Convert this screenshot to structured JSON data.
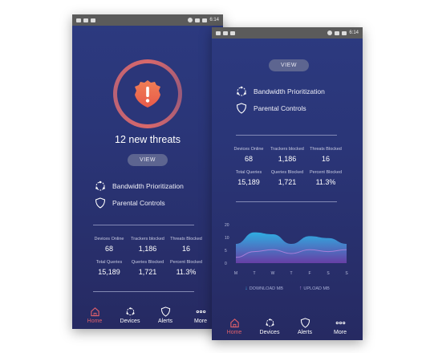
{
  "status_bar": {
    "time": "6:14"
  },
  "left_screen": {
    "threat_count_text": "12 new threats",
    "view_label": "VIEW",
    "features": [
      {
        "label": "Bandwidth Prioritization",
        "icon": "network-icon"
      },
      {
        "label": "Parental Controls",
        "icon": "shield-icon"
      }
    ],
    "stats": [
      {
        "label": "Devices Online",
        "value": "68"
      },
      {
        "label": "Trackers blocked",
        "value": "1,186"
      },
      {
        "label": "Threats Blocked",
        "value": "16"
      },
      {
        "label": "Total Queries",
        "value": "15,189"
      },
      {
        "label": "Queries Blocked",
        "value": "1,721"
      },
      {
        "label": "Percent Blocked",
        "value": "11.3%"
      }
    ]
  },
  "right_screen": {
    "view_label": "VIEW",
    "features": [
      {
        "label": "Bandwidth Prioritization",
        "icon": "network-icon"
      },
      {
        "label": "Parental Controls",
        "icon": "shield-icon"
      }
    ],
    "stats": [
      {
        "label": "Devices Online",
        "value": "68"
      },
      {
        "label": "Trackers blocked",
        "value": "1,186"
      },
      {
        "label": "Threats Blocked",
        "value": "16"
      },
      {
        "label": "Total Queries",
        "value": "15,189"
      },
      {
        "label": "Queries Blocked",
        "value": "1,721"
      },
      {
        "label": "Percent Blocked",
        "value": "11.3%"
      }
    ],
    "legend": {
      "download": "DOWNLOAD MB",
      "upload": "UPLOAD MB"
    }
  },
  "chart_data": {
    "type": "area",
    "categories": [
      "M",
      "T",
      "W",
      "T",
      "F",
      "S",
      "S"
    ],
    "ylim": [
      0,
      20
    ],
    "yticks": [
      "20",
      "10",
      "5",
      "0"
    ],
    "series": [
      {
        "name": "DOWNLOAD MB",
        "values": [
          10,
          16,
          15,
          10,
          14,
          13,
          10
        ]
      },
      {
        "name": "UPLOAD MB",
        "values": [
          3,
          6,
          7,
          5,
          7,
          6,
          7
        ]
      }
    ]
  },
  "nav": [
    {
      "label": "Home",
      "icon": "home-icon",
      "active": true
    },
    {
      "label": "Devices",
      "icon": "devices-icon",
      "active": false
    },
    {
      "label": "Alerts",
      "icon": "shield-icon",
      "active": false
    },
    {
      "label": "More",
      "icon": "more-icon",
      "active": false
    }
  ],
  "colors": {
    "accent": "#e0606a",
    "background_top": "#2c3a80",
    "background_bottom": "#262a62",
    "chart_fill_top": "#2fa8e0",
    "chart_fill_bottom": "#6a3fa8"
  }
}
